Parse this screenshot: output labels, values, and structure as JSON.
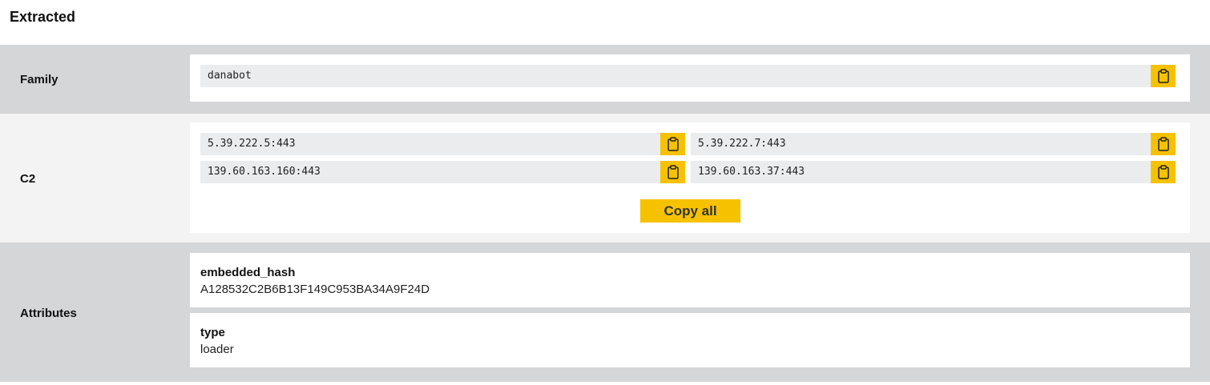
{
  "page": {
    "title": "Extracted"
  },
  "family": {
    "label": "Family",
    "value": "danabot"
  },
  "c2": {
    "label": "C2",
    "entries": [
      "5.39.222.5:443",
      "5.39.222.7:443",
      "139.60.163.160:443",
      "139.60.163.37:443"
    ],
    "copy_all_label": "Copy all"
  },
  "attributes": {
    "label": "Attributes",
    "items": [
      {
        "key": "embedded_hash",
        "value": "A128532C2B6B13F149C953BA34A9F24D"
      },
      {
        "key": "type",
        "value": "loader"
      }
    ]
  },
  "colors": {
    "accent": "#f6c200",
    "section_dark": "#d5d6d8",
    "section_light": "#f3f3f3",
    "field_bg": "#ebecee"
  },
  "icons": {
    "copy": "clipboard-icon"
  }
}
